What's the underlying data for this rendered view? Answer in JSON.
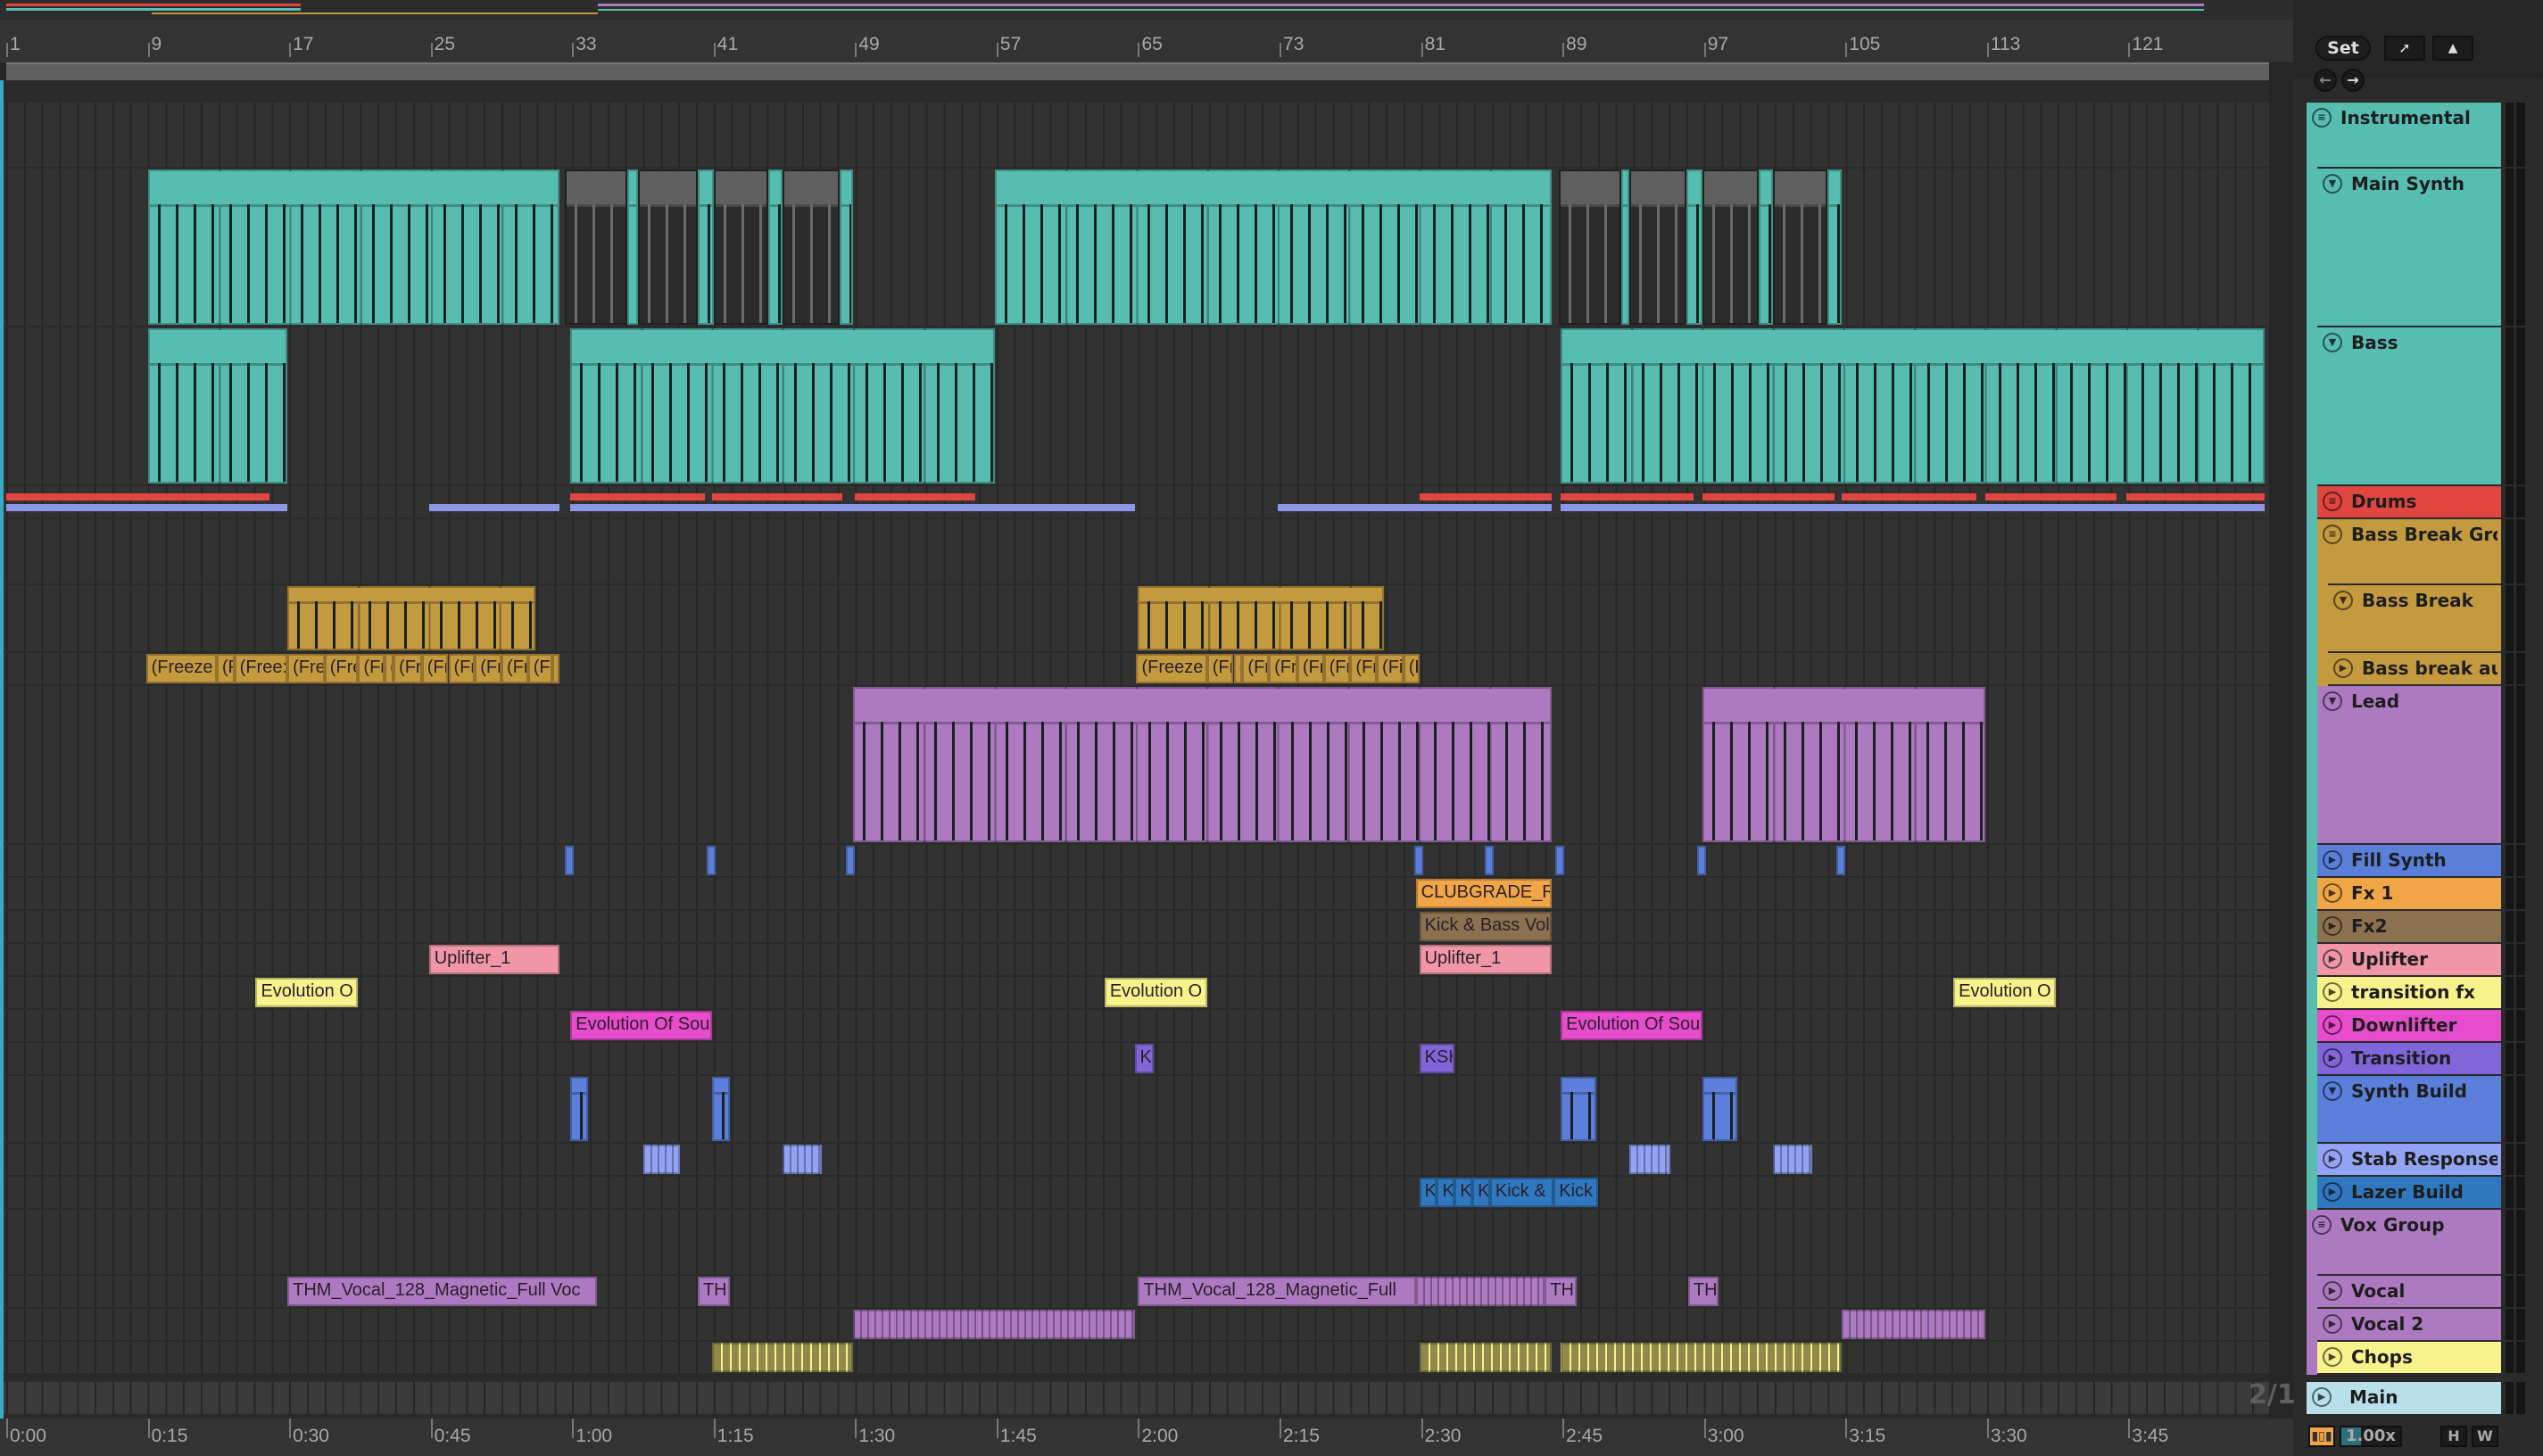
{
  "ruler": {
    "bars": [
      "1",
      "9",
      "17",
      "25",
      "33",
      "41",
      "49",
      "57",
      "65",
      "73",
      "81",
      "89",
      "97",
      "105",
      "113",
      "121"
    ],
    "times": [
      "0:00",
      "0:15",
      "0:30",
      "0:45",
      "1:00",
      "1:15",
      "1:30",
      "1:45",
      "2:00",
      "2:15",
      "2:30",
      "2:45",
      "3:00",
      "3:15",
      "3:30",
      "3:45"
    ]
  },
  "controls": {
    "set_label": "Set",
    "zoom_value": "1.00x",
    "h_label": "H",
    "w_label": "W",
    "page_indicator": "2/1"
  },
  "colors": {
    "teal": "#56bdb0",
    "red": "#e0453f",
    "drumblue": "#8d97e6",
    "gold": "#c49a3f",
    "purple": "#ad7ac2",
    "fill": "#5a7fd9",
    "fx1": "#f0a646",
    "fx2": "#8c7150",
    "uplifter": "#f096a6",
    "transfx": "#f7f28c",
    "down": "#e64ccc",
    "trans": "#8066d9",
    "stab": "#92a3f5",
    "lazer": "#2f78c0",
    "main": "#b9dfea",
    "chopsclip": "#8f8a4a"
  },
  "tracks": [
    {
      "name": "Instrumental",
      "icon": "group-icon",
      "type": "group",
      "depth": 0,
      "color": "#56bdb0",
      "clips": []
    },
    {
      "name": "Main Synth",
      "icon": "fold-icon",
      "type": "tall",
      "depth": 1,
      "color": "#56bdb0",
      "clips": [
        {
          "s": 9,
          "e": 32.3,
          "kind": "midi"
        },
        {
          "s": 32.6,
          "e": 36.1,
          "kind": "muted"
        },
        {
          "s": 36.1,
          "e": 36.7,
          "kind": "midi"
        },
        {
          "s": 36.7,
          "e": 40.1,
          "kind": "muted"
        },
        {
          "s": 40.1,
          "e": 41,
          "kind": "midi"
        },
        {
          "s": 41,
          "e": 44.1,
          "kind": "muted"
        },
        {
          "s": 44.1,
          "e": 44.9,
          "kind": "midi"
        },
        {
          "s": 44.9,
          "e": 48.1,
          "kind": "muted"
        },
        {
          "s": 48.1,
          "e": 48.9,
          "kind": "midi"
        },
        {
          "s": 56.9,
          "e": 88.4,
          "kind": "midi"
        },
        {
          "s": 88.8,
          "e": 92.3,
          "kind": "muted"
        },
        {
          "s": 92.3,
          "e": 92.8,
          "kind": "midi"
        },
        {
          "s": 92.8,
          "e": 96,
          "kind": "muted"
        },
        {
          "s": 96,
          "e": 96.9,
          "kind": "midi"
        },
        {
          "s": 96.9,
          "e": 100.1,
          "kind": "muted"
        },
        {
          "s": 100.1,
          "e": 100.9,
          "kind": "midi"
        },
        {
          "s": 100.9,
          "e": 104,
          "kind": "muted"
        },
        {
          "s": 104,
          "e": 104.8,
          "kind": "midi"
        }
      ]
    },
    {
      "name": "Bass",
      "icon": "fold-icon",
      "type": "tall",
      "depth": 1,
      "color": "#56bdb0",
      "clips": [
        {
          "s": 9,
          "e": 16.9,
          "kind": "midi"
        },
        {
          "s": 32.9,
          "e": 56.9,
          "kind": "midi"
        },
        {
          "s": 88.9,
          "e": 128.7,
          "kind": "midi"
        }
      ]
    },
    {
      "name": "Drums",
      "icon": "group-icon",
      "type": "small",
      "depth": 1,
      "color": "#e0453f",
      "clips": [],
      "lanes": {
        "red": [
          [
            1,
            15.9
          ],
          [
            32.9,
            40.5
          ],
          [
            40.9,
            48.3
          ],
          [
            49,
            55.8
          ],
          [
            80.9,
            88.4
          ],
          [
            88.9,
            96.4
          ],
          [
            96.9,
            104.4
          ],
          [
            104.8,
            112.4
          ],
          [
            112.9,
            120.3
          ],
          [
            120.9,
            128.7
          ]
        ],
        "blue": [
          [
            1,
            16.9
          ],
          [
            24.9,
            32.3
          ],
          [
            32.9,
            64.8
          ],
          [
            72.9,
            88.4
          ],
          [
            88.9,
            128.7
          ]
        ]
      }
    },
    {
      "name": "Bass Break Grou",
      "icon": "group-icon",
      "type": "group",
      "depth": 1,
      "color": "#c49a3f",
      "clips": []
    },
    {
      "name": "Bass Break",
      "icon": "fold-icon",
      "type": "medium",
      "depth": 2,
      "color": "#c49a3f",
      "clips": [
        {
          "s": 16.9,
          "e": 30.9,
          "kind": "midi"
        },
        {
          "s": 65,
          "e": 78.9,
          "kind": "midi"
        }
      ]
    },
    {
      "name": "Bass break audi",
      "icon": "play-icon",
      "type": "small",
      "depth": 2,
      "color": "#c49a3f",
      "clips": [
        {
          "s": 8.9,
          "e": 12.9,
          "label": "(Freeze"
        },
        {
          "s": 12.9,
          "e": 13.9,
          "label": "(F"
        },
        {
          "s": 13.9,
          "e": 16.9,
          "label": "(Free:"
        },
        {
          "s": 16.9,
          "e": 19,
          "label": "(Fre"
        },
        {
          "s": 19,
          "e": 20.9,
          "label": "(Fre"
        },
        {
          "s": 20.9,
          "e": 22.4,
          "label": "(Fr"
        },
        {
          "s": 22.4,
          "e": 22.9,
          "label": "("
        },
        {
          "s": 22.9,
          "e": 24.5,
          "label": "(Fr"
        },
        {
          "s": 24.5,
          "e": 26,
          "label": "(Fr"
        },
        {
          "s": 26,
          "e": 27.5,
          "label": "(Fr"
        },
        {
          "s": 27.5,
          "e": 29,
          "label": "(Fr"
        },
        {
          "s": 29,
          "e": 30.5,
          "label": "(Fr"
        },
        {
          "s": 30.5,
          "e": 31.9,
          "label": "(Fr"
        },
        {
          "s": 31.9,
          "e": 32.3,
          "label": "("
        },
        {
          "s": 64.9,
          "e": 68.9,
          "label": "(Freeze"
        },
        {
          "s": 68.9,
          "e": 70.4,
          "label": "(Fr"
        },
        {
          "s": 70.4,
          "e": 70.9,
          "label": "("
        },
        {
          "s": 70.9,
          "e": 72.4,
          "label": "(Fr"
        },
        {
          "s": 72.4,
          "e": 74,
          "label": "(Fr"
        },
        {
          "s": 74,
          "e": 75.5,
          "label": "(Fr"
        },
        {
          "s": 75.5,
          "e": 77,
          "label": "(Fr"
        },
        {
          "s": 77,
          "e": 78.5,
          "label": "(Fr"
        },
        {
          "s": 78.5,
          "e": 80,
          "label": "(Fi"
        },
        {
          "s": 80,
          "e": 80.9,
          "label": "(F"
        }
      ]
    },
    {
      "name": "Lead",
      "icon": "fold-icon",
      "type": "tall",
      "depth": 1,
      "color": "#ad7ac2",
      "clips": [
        {
          "s": 48.9,
          "e": 88.4,
          "kind": "midi"
        },
        {
          "s": 96.9,
          "e": 112.9,
          "kind": "midi"
        }
      ]
    },
    {
      "name": "Fill Synth",
      "icon": "play-icon",
      "type": "small",
      "depth": 1,
      "color": "#5a7fd9",
      "clips": [
        {
          "s": 32.6,
          "e": 33.1
        },
        {
          "s": 40.6,
          "e": 41.1
        },
        {
          "s": 48.5,
          "e": 49
        },
        {
          "s": 80.6,
          "e": 81.1
        },
        {
          "s": 84.6,
          "e": 85.1
        },
        {
          "s": 88.6,
          "e": 89.1
        },
        {
          "s": 96.6,
          "e": 97.1
        },
        {
          "s": 104.5,
          "e": 105
        }
      ]
    },
    {
      "name": "Fx 1",
      "icon": "play-icon",
      "type": "small",
      "depth": 1,
      "color": "#f0a646",
      "clips": [
        {
          "s": 80.7,
          "e": 88.4,
          "label": "CLUBGRADE_Ri"
        }
      ]
    },
    {
      "name": "Fx2",
      "icon": "play-icon",
      "type": "small",
      "depth": 1,
      "color": "#8c7150",
      "clips": [
        {
          "s": 80.9,
          "e": 88.4,
          "label": "Kick & Bass Vol"
        }
      ]
    },
    {
      "name": "Uplifter",
      "icon": "play-icon",
      "type": "small",
      "depth": 1,
      "color": "#f096a6",
      "clips": [
        {
          "s": 24.9,
          "e": 32.3,
          "label": "Uplifter_1"
        },
        {
          "s": 80.9,
          "e": 88.4,
          "label": "Uplifter_1"
        }
      ]
    },
    {
      "name": "transition fx",
      "icon": "play-icon",
      "type": "small",
      "depth": 1,
      "color": "#f7f28c",
      "clips": [
        {
          "s": 15.1,
          "e": 20.9,
          "label": "Evolution O"
        },
        {
          "s": 63.1,
          "e": 68.9,
          "label": "Evolution O"
        },
        {
          "s": 111.1,
          "e": 116.9,
          "label": "Evolution O"
        }
      ]
    },
    {
      "name": "Downlifter",
      "icon": "play-icon",
      "type": "small",
      "depth": 1,
      "color": "#e64ccc",
      "clips": [
        {
          "s": 32.9,
          "e": 40.9,
          "label": "Evolution Of Sou"
        },
        {
          "s": 88.9,
          "e": 96.9,
          "label": "Evolution Of Sou"
        }
      ]
    },
    {
      "name": "Transition",
      "icon": "play-icon",
      "type": "small",
      "depth": 1,
      "color": "#8066d9",
      "clips": [
        {
          "s": 64.8,
          "e": 65.9,
          "label": "KS"
        },
        {
          "s": 80.9,
          "e": 82.9,
          "label": "KSH"
        }
      ]
    },
    {
      "name": "Synth Build",
      "icon": "fold-icon",
      "type": "medium",
      "depth": 1,
      "color": "#5b7fdb",
      "clips": [
        {
          "s": 32.9,
          "e": 33.9,
          "kind": "midi"
        },
        {
          "s": 40.9,
          "e": 41.9,
          "kind": "midi"
        },
        {
          "s": 88.9,
          "e": 90.9,
          "kind": "midi"
        },
        {
          "s": 96.9,
          "e": 98.9,
          "kind": "midi"
        }
      ]
    },
    {
      "name": "Stab Response",
      "icon": "play-icon",
      "type": "small",
      "depth": 1,
      "color": "#92a3f5",
      "clips": [
        {
          "s": 37,
          "e": 39.1,
          "kind": "chop"
        },
        {
          "s": 44.9,
          "e": 47.1,
          "kind": "chop"
        },
        {
          "s": 92.8,
          "e": 95.1,
          "kind": "chop"
        },
        {
          "s": 100.9,
          "e": 103.1,
          "kind": "chop"
        }
      ]
    },
    {
      "name": "Lazer Build",
      "icon": "play-icon",
      "type": "small",
      "depth": 1,
      "color": "#2f78c0",
      "clips": [
        {
          "s": 80.9,
          "e": 81.9,
          "label": "K"
        },
        {
          "s": 81.9,
          "e": 82.9,
          "label": "K"
        },
        {
          "s": 82.9,
          "e": 83.9,
          "label": "K"
        },
        {
          "s": 83.9,
          "e": 84.9,
          "label": "K"
        },
        {
          "s": 84.9,
          "e": 88.5,
          "label": "Kick &"
        },
        {
          "s": 88.5,
          "e": 91,
          "label": "Kick"
        }
      ]
    },
    {
      "name": "Vox Group",
      "icon": "group-icon",
      "type": "group",
      "depth": 0,
      "color": "#ad7ac2",
      "clips": []
    },
    {
      "name": "Vocal",
      "icon": "play-icon",
      "type": "small",
      "depth": 1,
      "color": "#ad7ac2",
      "clips": [
        {
          "s": 16.9,
          "e": 34.4,
          "label": "THM_Vocal_128_Magnetic_Full Voc"
        },
        {
          "s": 40.1,
          "e": 41.9,
          "label": "TH"
        },
        {
          "s": 65,
          "e": 80.7,
          "label": "THM_Vocal_128_Magnetic_Full"
        },
        {
          "s": 80.7,
          "e": 88,
          "kind": "chop"
        },
        {
          "s": 88,
          "e": 89.8,
          "label": "THM"
        },
        {
          "s": 96.1,
          "e": 97.8,
          "label": "TH"
        }
      ]
    },
    {
      "name": "Vocal 2",
      "icon": "play-icon",
      "type": "small",
      "depth": 1,
      "color": "#ad7ac2",
      "clips": [
        {
          "s": 48.9,
          "e": 64.8,
          "kind": "chop"
        },
        {
          "s": 104.8,
          "e": 112.9,
          "kind": "chop"
        }
      ]
    },
    {
      "name": "Chops",
      "icon": "play-icon",
      "type": "small",
      "depth": 1,
      "color": "#f7f28c",
      "clipcolor": "#8f8a4a",
      "clips": [
        {
          "s": 40.9,
          "e": 48.9,
          "kind": "chops"
        },
        {
          "s": 80.9,
          "e": 88.4,
          "kind": "chops"
        },
        {
          "s": 88.9,
          "e": 104.8,
          "kind": "chops"
        }
      ]
    }
  ],
  "main_track": {
    "name": "Main",
    "icon": "play-icon",
    "color": "#b9dfea"
  }
}
